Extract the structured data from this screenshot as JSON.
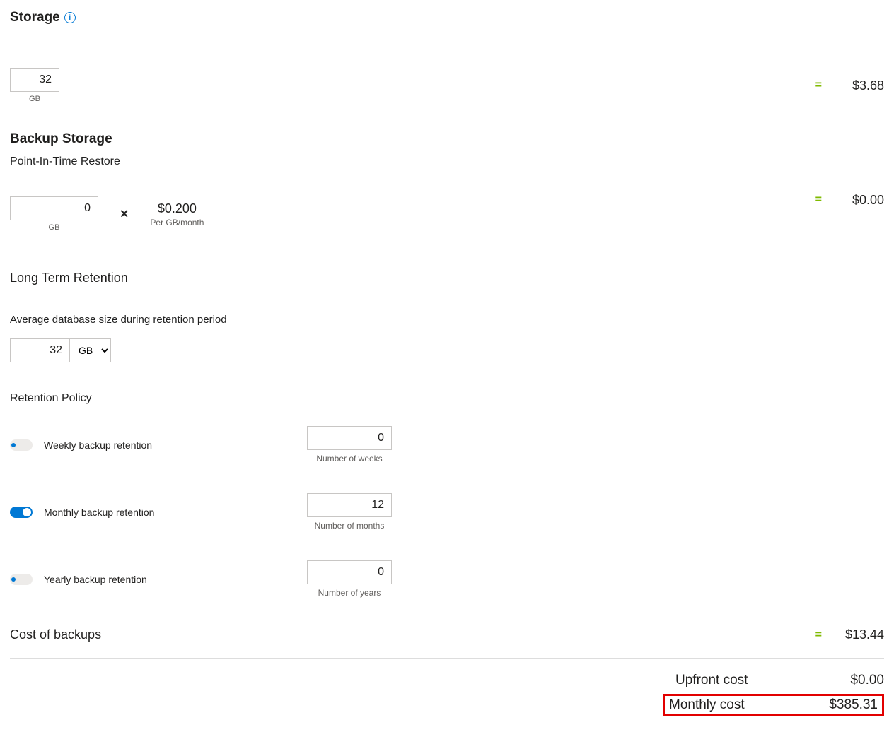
{
  "storage": {
    "title": "Storage",
    "value": "32",
    "unit": "GB",
    "cost": "$3.68"
  },
  "backup": {
    "title": "Backup Storage",
    "subtitle": "Point-In-Time Restore",
    "pitr": {
      "value": "0",
      "unit": "GB",
      "multiply": "✕",
      "price": "$0.200",
      "price_unit": "Per GB/month",
      "cost": "$0.00"
    }
  },
  "ltr": {
    "title": "Long Term Retention",
    "avg_label": "Average database size during retention period",
    "avg_value": "32",
    "avg_unit": "GB",
    "policy_label": "Retention Policy",
    "weekly": {
      "label": "Weekly backup retention",
      "value": "0",
      "caption": "Number of weeks",
      "on": false
    },
    "monthly": {
      "label": "Monthly backup retention",
      "value": "12",
      "caption": "Number of months",
      "on": true
    },
    "yearly": {
      "label": "Yearly backup retention",
      "value": "0",
      "caption": "Number of years",
      "on": false
    }
  },
  "cost_of_backups": {
    "label": "Cost of backups",
    "value": "$13.44"
  },
  "totals": {
    "upfront_label": "Upfront cost",
    "upfront_value": "$0.00",
    "monthly_label": "Monthly cost",
    "monthly_value": "$385.31"
  },
  "equals": "="
}
